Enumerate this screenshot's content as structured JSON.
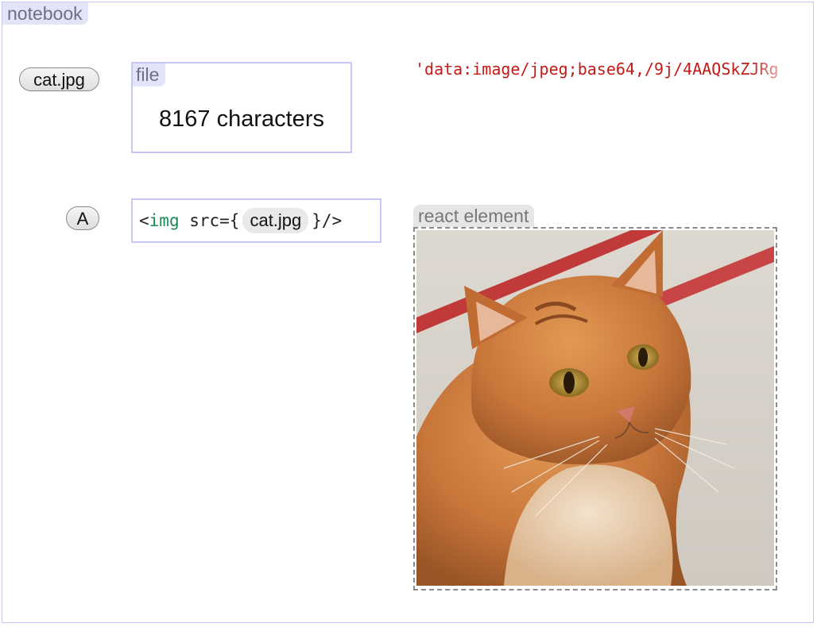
{
  "notebook": {
    "label": "notebook"
  },
  "cells": {
    "file_cell": {
      "pill_label": "cat.jpg",
      "box_tag": "file",
      "summary": "8167 characters",
      "output_preview": "'data:image/jpeg;base64,/9j/4AAQSkZJRg"
    },
    "jsx_cell": {
      "pill_label": "A",
      "code_open": "<",
      "code_tag": "img",
      "code_attr": " src={",
      "code_ref": "cat.jpg",
      "code_close": "}/>",
      "output_tag": "react element",
      "image_subject": "orange tabby cat"
    }
  },
  "colors": {
    "frame_border": "#c7c8f3",
    "tag_bg": "#e4e4f8",
    "string_red": "#c41a16",
    "keyword_green": "#1d8a55"
  }
}
